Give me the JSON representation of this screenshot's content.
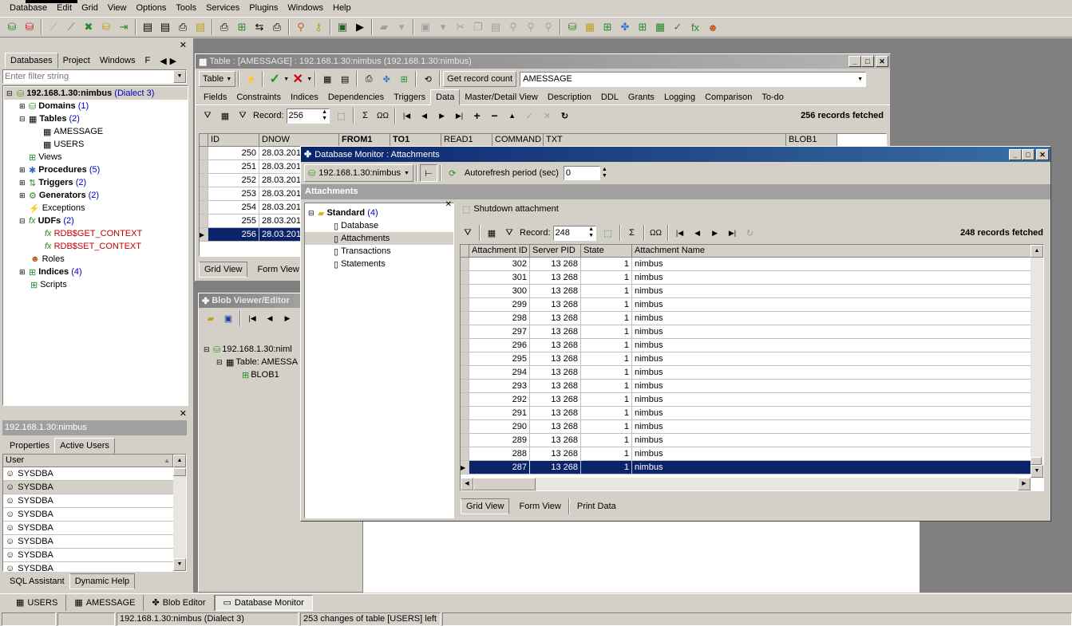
{
  "menu": [
    "Database",
    "Edit",
    "Grid",
    "View",
    "Options",
    "Tools",
    "Services",
    "Plugins",
    "Windows",
    "Help"
  ],
  "left_panel": {
    "tabs": [
      "Databases",
      "Project",
      "Windows",
      "F"
    ],
    "filter_placeholder": "Enter filter string",
    "tree": {
      "db": "192.168.1.30:nimbus",
      "dialect": "(Dialect 3)",
      "domains": "Domains",
      "domains_count": "(1)",
      "tables": "Tables",
      "tables_count": "(2)",
      "table1": "AMESSAGE",
      "table2": "USERS",
      "views": "Views",
      "procedures": "Procedures",
      "procedures_count": "(5)",
      "triggers": "Triggers",
      "triggers_count": "(2)",
      "generators": "Generators",
      "generators_count": "(2)",
      "exceptions": "Exceptions",
      "udfs": "UDFs",
      "udfs_count": "(2)",
      "udf1": "RDB$GET_CONTEXT",
      "udf2": "RDB$SET_CONTEXT",
      "roles": "Roles",
      "indices": "Indices",
      "indices_count": "(4)",
      "scripts": "Scripts"
    }
  },
  "users_panel": {
    "title": "192.168.1.30:nimbus",
    "tabs": [
      "Properties",
      "Active Users"
    ],
    "column": "User",
    "users": [
      "SYSDBA",
      "SYSDBA",
      "SYSDBA",
      "SYSDBA",
      "SYSDBA",
      "SYSDBA",
      "SYSDBA",
      "SYSDBA"
    ],
    "bottom_tabs": [
      "SQL Assistant",
      "Dynamic Help"
    ]
  },
  "table_window": {
    "title": "Table : [AMESSAGE] : 192.168.1.30:nimbus (192.168.1.30:nimbus)",
    "table_btn": "Table",
    "get_record_count": "Get record count",
    "table_name": "AMESSAGE",
    "tabs": [
      "Fields",
      "Constraints",
      "Indices",
      "Dependencies",
      "Triggers",
      "Data",
      "Master/Detail View",
      "Description",
      "DDL",
      "Grants",
      "Logging",
      "Comparison",
      "To-do"
    ],
    "record_label": "Record:",
    "record_value": "256",
    "records_fetched": "256 records fetched",
    "columns": [
      "ID",
      "DNOW",
      "FROM1",
      "TO1",
      "READ1",
      "COMMAND",
      "TXT",
      "BLOB1"
    ],
    "rows": [
      {
        "id": "250",
        "dnow": "28.03.201"
      },
      {
        "id": "251",
        "dnow": "28.03.201"
      },
      {
        "id": "252",
        "dnow": "28.03.201"
      },
      {
        "id": "253",
        "dnow": "28.03.201"
      },
      {
        "id": "254",
        "dnow": "28.03.201"
      },
      {
        "id": "255",
        "dnow": "28.03.201"
      },
      {
        "id": "256",
        "dnow": "28.03.201"
      }
    ],
    "bottom_tabs": [
      "Grid View",
      "Form View"
    ]
  },
  "blob_window": {
    "title": "Blob Viewer/Editor",
    "tree": {
      "db": "192.168.1.30:niml",
      "table": "Table: AMESSA",
      "field": "BLOB1"
    }
  },
  "monitor_window": {
    "title": "Database Monitor : Attachments",
    "db_select": "192.168.1.30:nimbus",
    "autorefresh_label": "Autorefresh period (sec)",
    "autorefresh_value": "0",
    "section": "Attachments",
    "tree": {
      "root": "Standard",
      "root_count": "(4)",
      "items": [
        "Database",
        "Attachments",
        "Transactions",
        "Statements"
      ]
    },
    "shutdown": "Shutdown attachment",
    "record_label": "Record:",
    "record_value": "248",
    "records_fetched": "248 records fetched",
    "columns": [
      "Attachment ID",
      "Server PID",
      "State",
      "Attachment Name"
    ],
    "rows": [
      {
        "id": "302",
        "pid": "13 268",
        "state": "1",
        "name": "nimbus"
      },
      {
        "id": "301",
        "pid": "13 268",
        "state": "1",
        "name": "nimbus"
      },
      {
        "id": "300",
        "pid": "13 268",
        "state": "1",
        "name": "nimbus"
      },
      {
        "id": "299",
        "pid": "13 268",
        "state": "1",
        "name": "nimbus"
      },
      {
        "id": "298",
        "pid": "13 268",
        "state": "1",
        "name": "nimbus"
      },
      {
        "id": "297",
        "pid": "13 268",
        "state": "1",
        "name": "nimbus"
      },
      {
        "id": "296",
        "pid": "13 268",
        "state": "1",
        "name": "nimbus"
      },
      {
        "id": "295",
        "pid": "13 268",
        "state": "1",
        "name": "nimbus"
      },
      {
        "id": "294",
        "pid": "13 268",
        "state": "1",
        "name": "nimbus"
      },
      {
        "id": "293",
        "pid": "13 268",
        "state": "1",
        "name": "nimbus"
      },
      {
        "id": "292",
        "pid": "13 268",
        "state": "1",
        "name": "nimbus"
      },
      {
        "id": "291",
        "pid": "13 268",
        "state": "1",
        "name": "nimbus"
      },
      {
        "id": "290",
        "pid": "13 268",
        "state": "1",
        "name": "nimbus"
      },
      {
        "id": "289",
        "pid": "13 268",
        "state": "1",
        "name": "nimbus"
      },
      {
        "id": "288",
        "pid": "13 268",
        "state": "1",
        "name": "nimbus"
      },
      {
        "id": "287",
        "pid": "13 268",
        "state": "1",
        "name": "nimbus"
      }
    ],
    "bottom_tabs": [
      "Grid View",
      "Form View",
      "Print Data"
    ]
  },
  "taskbar": [
    "USERS",
    "AMESSAGE",
    "Blob Editor",
    "Database Monitor"
  ],
  "statusbar": {
    "db": "192.168.1.30:nimbus (Dialect 3)",
    "msg": "253 changes of table [USERS] left"
  },
  "colors": {
    "title_active": "#0a246a",
    "selection": "#0a246a",
    "face": "#d4d0c8",
    "workspace": "#808080"
  }
}
